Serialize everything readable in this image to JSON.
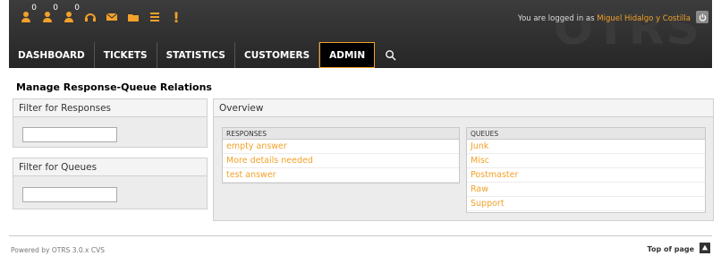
{
  "toolbar": {
    "items": [
      {
        "icon": "user-locked-icon",
        "count": "0"
      },
      {
        "icon": "user-watched-icon",
        "count": "0"
      },
      {
        "icon": "user-responsible-icon",
        "count": "0"
      },
      {
        "icon": "headset-icon"
      },
      {
        "icon": "email-icon"
      },
      {
        "icon": "folder-icon"
      },
      {
        "icon": "list-icon"
      },
      {
        "icon": "exclamation-icon",
        "label": "!"
      }
    ]
  },
  "header": {
    "logo": "OTRS",
    "login_prefix": "You are logged in as",
    "user_name": "Miguel Hidalgo y Costilla"
  },
  "nav": {
    "items": [
      "DASHBOARD",
      "TICKETS",
      "STATISTICS",
      "CUSTOMERS",
      "ADMIN"
    ],
    "selected": "ADMIN"
  },
  "page": {
    "title": "Manage Response-Queue Relations"
  },
  "filters": {
    "responses_title": "Filter for Responses",
    "queues_title": "Filter for Queues",
    "responses_value": "",
    "queues_value": ""
  },
  "overview": {
    "title": "Overview",
    "responses_header": "RESPONSES",
    "queues_header": "QUEUES",
    "responses": [
      "empty answer",
      "More details needed",
      "test answer"
    ],
    "queues": [
      "Junk",
      "Misc",
      "Postmaster",
      "Raw",
      "Support"
    ]
  },
  "footer": {
    "powered_by": "Powered by OTRS 3.0.x CVS",
    "top_of_page": "Top of page"
  },
  "colors": {
    "accent": "#f2a12a",
    "header_bg": "#2e2e2e"
  }
}
